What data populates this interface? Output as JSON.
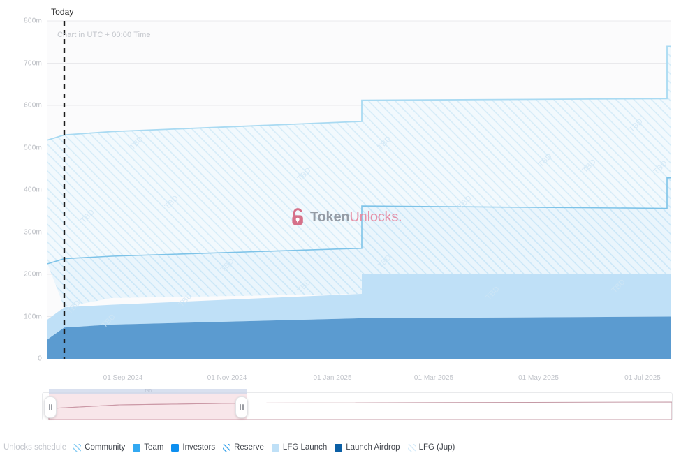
{
  "header": {
    "today_label": "Today",
    "utc_note": "Chart in UTC + 00:00 Time"
  },
  "watermark": {
    "icon": "padlock-icon",
    "text_primary": "Token",
    "text_secondary": "Unlocks."
  },
  "legend": {
    "title": "Unlocks schedule",
    "items": [
      {
        "label": "Community",
        "color": "#9fd4f0",
        "pattern": "hatched"
      },
      {
        "label": "Team",
        "color": "#33a9f2",
        "pattern": "solid"
      },
      {
        "label": "Investors",
        "color": "#0d8ff0",
        "pattern": "solid"
      },
      {
        "label": "Reserve",
        "color": "#3ba9ee",
        "pattern": "hatched"
      },
      {
        "label": "LFG Launch",
        "color": "#bfe0f7",
        "pattern": "solid"
      },
      {
        "label": "Launch Airdrop",
        "color": "#0b5fa5",
        "pattern": "solid"
      },
      {
        "label": "LFG (Jup)",
        "color": "#d9edfa",
        "pattern": "hatched"
      }
    ]
  },
  "brush": {
    "selection_label": "TBD",
    "left_handle": "range-start-handle",
    "right_handle": "range-end-handle"
  },
  "chart_data": {
    "type": "area",
    "title": "",
    "subtitle": "Chart in UTC + 00:00 Time",
    "xlabel": "",
    "ylabel": "",
    "stacked": true,
    "grid": true,
    "legend_position": "bottom",
    "ylim": [
      0,
      800000000
    ],
    "ytick_labels": [
      "0",
      "100m",
      "200m",
      "300m",
      "400m",
      "500m",
      "600m",
      "700m",
      "800m"
    ],
    "ytick_values": [
      0,
      100000000,
      200000000,
      300000000,
      400000000,
      500000000,
      600000000,
      700000000,
      800000000
    ],
    "xtick_labels": [
      "01 Sep 2024",
      "01 Nov 2024",
      "01 Jan 2025",
      "01 Mar 2025",
      "01 May 2025",
      "01 Jul 2025"
    ],
    "xlim": [
      "2024-08-01",
      "2025-07-20"
    ],
    "annotations": [
      {
        "type": "vline",
        "label": "Today",
        "x": "2024-08-07",
        "style": "dashed",
        "color": "#1b1b1b"
      }
    ],
    "series": [
      {
        "name": "Launch Airdrop",
        "color": "#5b9bd0",
        "pattern": "solid",
        "points": [
          {
            "x": "2024-08-01",
            "y": 46000000
          },
          {
            "x": "2024-08-07",
            "y": 74000000
          },
          {
            "x": "2024-09-01",
            "y": 81000000
          },
          {
            "x": "2025-01-15",
            "y": 96000000
          },
          {
            "x": "2025-07-20",
            "y": 100000000
          }
        ]
      },
      {
        "name": "LFG Launch",
        "color": "#bfe0f7",
        "pattern": "solid",
        "points": [
          {
            "x": "2024-08-01",
            "y": 93000000
          },
          {
            "x": "2024-08-07",
            "y": 122000000
          },
          {
            "x": "2024-09-01",
            "y": 128000000
          },
          {
            "x": "2025-01-15",
            "y": 152000000
          },
          {
            "x": "2025-01-16",
            "y": 200000000
          },
          {
            "x": "2025-07-20",
            "y": 200000000
          }
        ]
      },
      {
        "name": "Community",
        "color": "#dcefFB",
        "pattern": "hatched",
        "points": [
          {
            "x": "2024-08-01",
            "y": 225000000
          },
          {
            "x": "2024-08-07",
            "y": 237000000
          },
          {
            "x": "2024-09-01",
            "y": 243000000
          },
          {
            "x": "2025-01-15",
            "y": 262000000
          },
          {
            "x": "2025-01-16",
            "y": 350000000
          },
          {
            "x": "2025-07-18",
            "y": 356000000
          },
          {
            "x": "2025-07-19",
            "y": 430000000
          },
          {
            "x": "2025-07-20",
            "y": 430000000
          }
        ]
      },
      {
        "name": "LFG (Jup)",
        "color": "#eaf5fc",
        "pattern": "hatched",
        "points": [
          {
            "x": "2024-08-01",
            "y": 518000000
          },
          {
            "x": "2024-08-07",
            "y": 530000000
          },
          {
            "x": "2024-09-01",
            "y": 538000000
          },
          {
            "x": "2025-01-15",
            "y": 562000000
          },
          {
            "x": "2025-01-16",
            "y": 612000000
          },
          {
            "x": "2025-07-18",
            "y": 616000000
          },
          {
            "x": "2025-07-19",
            "y": 740000000
          },
          {
            "x": "2025-07-20",
            "y": 740000000
          }
        ]
      }
    ]
  }
}
